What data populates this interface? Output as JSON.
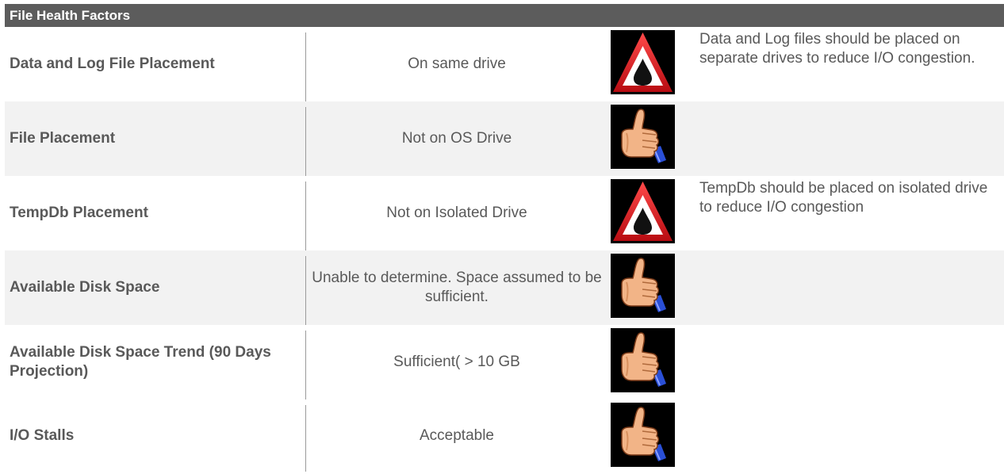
{
  "header": {
    "title": "File Health Factors"
  },
  "rows": [
    {
      "factor": "Data and Log File Placement",
      "status": "On same drive",
      "icon": "warning-triangle-icon",
      "note": "Data and Log files should be placed on separate drives to reduce I/O congestion."
    },
    {
      "factor": "File Placement",
      "status": "Not on OS Drive",
      "icon": "thumbs-up-icon",
      "note": ""
    },
    {
      "factor": "TempDb Placement",
      "status": "Not on Isolated Drive",
      "icon": "warning-triangle-icon",
      "note": "TempDb should be placed on isolated drive to reduce I/O congestion"
    },
    {
      "factor": "Available Disk Space",
      "status": "Unable to determine. Space assumed to be sufficient.",
      "icon": "thumbs-up-icon",
      "note": ""
    },
    {
      "factor": "Available Disk Space Trend (90 Days Projection)",
      "status": "Sufficient( > 10 GB",
      "icon": "thumbs-up-icon",
      "note": ""
    },
    {
      "factor": "I/O Stalls",
      "status": "Acceptable",
      "icon": "thumbs-up-icon",
      "note": ""
    }
  ],
  "colors": {
    "header_bg": "#5c5c5c",
    "row_shade": "#f2f2f2",
    "text": "#595959",
    "warning_red": "#d8141c"
  }
}
